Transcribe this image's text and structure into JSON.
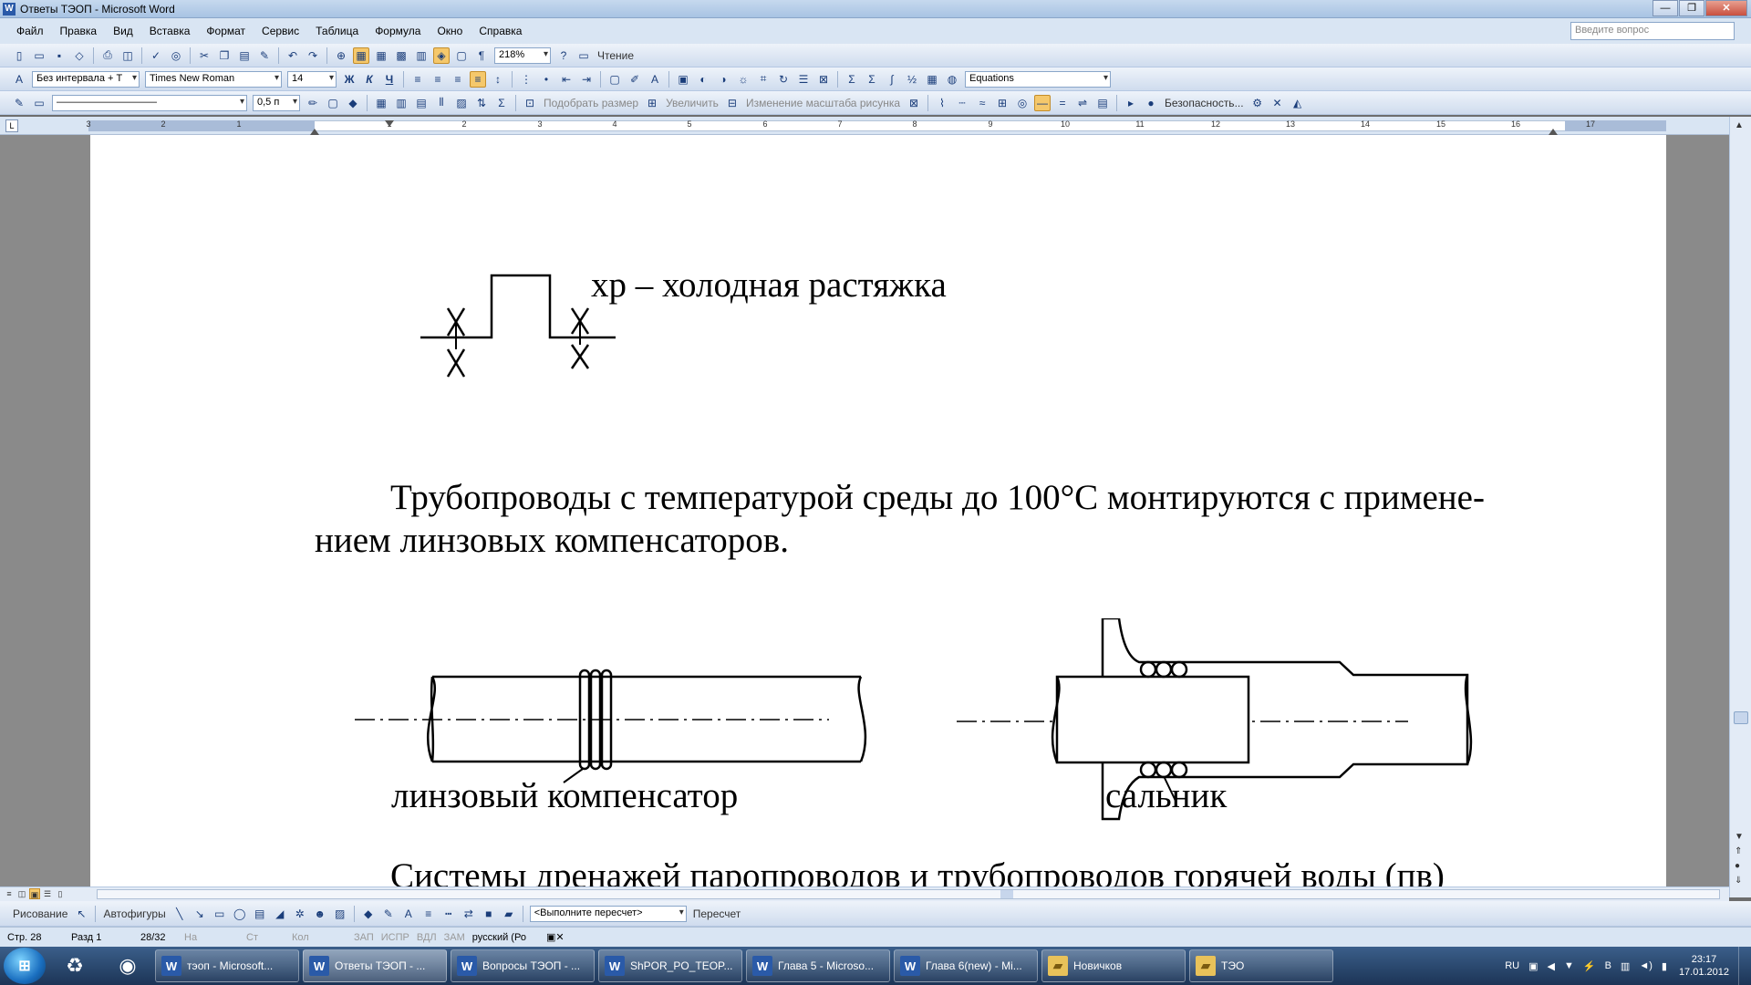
{
  "window": {
    "title": "Ответы ТЭОП - Microsoft Word",
    "app_icon": "W"
  },
  "menu": [
    "Файл",
    "Правка",
    "Вид",
    "Вставка",
    "Формат",
    "Сервис",
    "Таблица",
    "Формула",
    "Окно",
    "Справка"
  ],
  "help_box": {
    "placeholder": "Введите вопрос"
  },
  "toolbar_standard": {
    "zoom": "218%",
    "reading_label": "Чтение"
  },
  "toolbar_format": {
    "style": "Без интервала + Т",
    "font": "Times New Roman",
    "size": "14",
    "bold": "Ж",
    "italic": "К",
    "underline": "Ч",
    "equations": "Equations"
  },
  "toolbar_drawing_top": {
    "line_weight": "0,5 п",
    "fit_size": "Подобрать размер",
    "enlarge": "Увеличить",
    "scale_image": "Изменение масштаба рисунка",
    "security": "Безопасность..."
  },
  "ruler": {
    "numbers": [
      "3",
      "2",
      "1",
      "1",
      "2",
      "3",
      "4",
      "5",
      "6",
      "7",
      "8",
      "9",
      "10",
      "11",
      "12",
      "13",
      "14",
      "15",
      "16",
      "17"
    ],
    "corner": "L"
  },
  "document": {
    "fig1_label": "хр – холодная растяжка",
    "para1_line1": "Трубопроводы с температурой среды до 100°С монтируются с примене-",
    "para1_line2": "нием линзовых компенсаторов.",
    "fig2_label_left": "линзовый компенсатор",
    "fig2_label_right": "сальник",
    "para2_line1": "Системы дренажей паропроводов и трубопроводов горячей воды (пв)"
  },
  "drawing_bar": {
    "drawing": "Рисование",
    "autoshapes": "Автофигуры",
    "recalc_placeholder": "<Выполните пересчет>",
    "recalc": "Пересчет"
  },
  "status": {
    "page": "Стр. 28",
    "section": "Разд 1",
    "pages": "28/32",
    "at": "На",
    "line": "Ст",
    "col": "Кол",
    "rec": "ЗАП",
    "trk": "ИСПР",
    "ext": "ВДЛ",
    "ovr": "ЗАМ",
    "lang": "русский (Ро"
  },
  "taskbar": {
    "items": [
      {
        "label": "тэоп - Microsoft...",
        "icon": "word"
      },
      {
        "label": "Ответы ТЭОП - ...",
        "icon": "word"
      },
      {
        "label": "Вопросы ТЭОП - ...",
        "icon": "word"
      },
      {
        "label": "ShPOR_PO_TEOP...",
        "icon": "word"
      },
      {
        "label": "Глава 5 - Microso...",
        "icon": "word"
      },
      {
        "label": "Глава 6(new) - Mi...",
        "icon": "word"
      },
      {
        "label": "Новичков",
        "icon": "folder"
      },
      {
        "label": "ТЭО",
        "icon": "folder"
      }
    ],
    "lang": "RU",
    "time": "23:17",
    "date": "17.01.2012"
  }
}
